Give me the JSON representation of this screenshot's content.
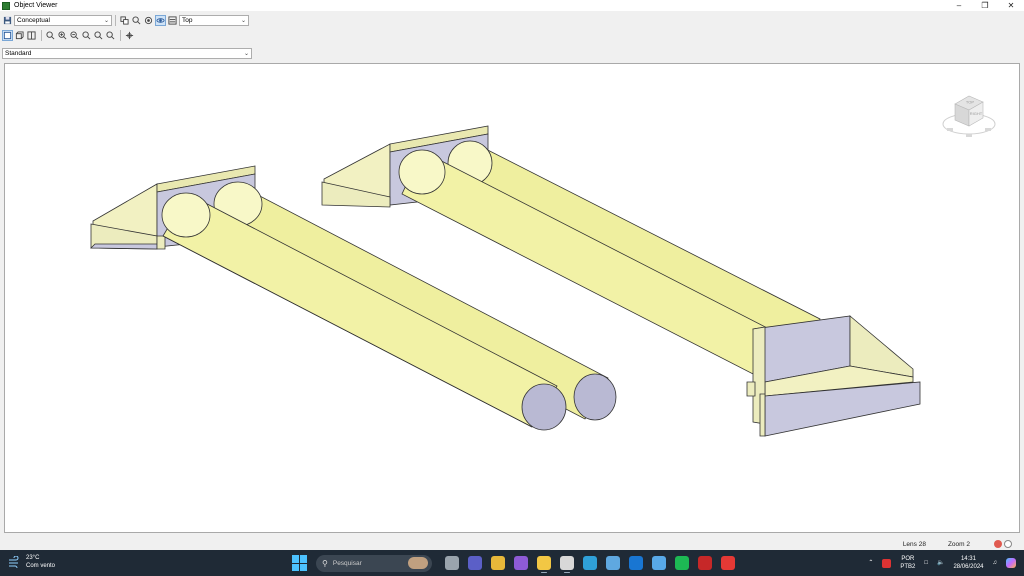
{
  "window": {
    "title": "Object Viewer",
    "controls": [
      "minimize",
      "restore",
      "close"
    ]
  },
  "toolbar": {
    "visual_style": "Conceptual",
    "view": "Top",
    "ucs": "Standard"
  },
  "viewcube": {
    "faces": [
      "TOP",
      "RIGHT"
    ]
  },
  "status": {
    "lens": "Lens 28",
    "zoom": "Zoom 2"
  },
  "taskbar": {
    "weather_temp": "23°C",
    "weather_desc": "Com vento",
    "search_placeholder": "Pesquisar",
    "apps": [
      {
        "name": "task-view",
        "color": "#9aa4ad"
      },
      {
        "name": "teams",
        "color": "#5b5fc7"
      },
      {
        "name": "chrome",
        "color": "#e8b83a"
      },
      {
        "name": "visual-studio",
        "color": "#8e5bd6"
      },
      {
        "name": "file-explorer",
        "color": "#f2c744"
      },
      {
        "name": "autocad",
        "color": "#d8d8d8"
      },
      {
        "name": "edge",
        "color": "#2fa0d8"
      },
      {
        "name": "photos",
        "color": "#5fa8e0"
      },
      {
        "name": "outlook",
        "color": "#1976d2"
      },
      {
        "name": "notepad",
        "color": "#58a9e8"
      },
      {
        "name": "spotify",
        "color": "#1db954"
      },
      {
        "name": "filezilla",
        "color": "#c62828"
      },
      {
        "name": "anydesk",
        "color": "#e53935"
      }
    ],
    "language": "POR",
    "keyboard": "PTB2",
    "time": "14:31",
    "date": "28/06/2024"
  }
}
